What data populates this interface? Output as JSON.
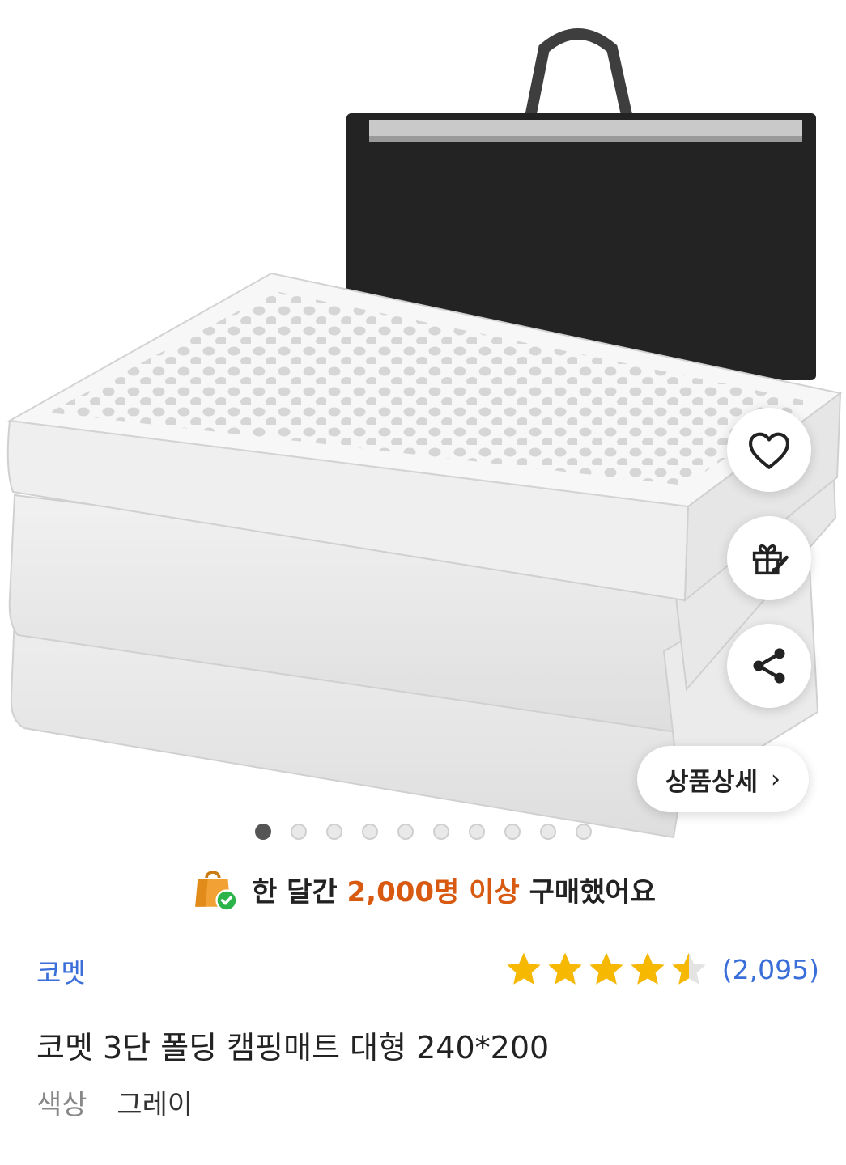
{
  "product": {
    "brand": "코멧",
    "title": "코멧 3단 폴딩 캠핑매트 대형 240*200",
    "rating_stars": 4.5,
    "review_count": "(2,095)",
    "option_label": "색상",
    "option_value": "그레이"
  },
  "gallery": {
    "image_alt": "코멧 3단 폴딩 캠핑매트",
    "total_images": 10,
    "current_index": 1,
    "detail_button_label": "상품상세",
    "detail_button_chevron": "›"
  },
  "actions": {
    "wishlist_icon": "heart-icon",
    "gift_icon": "gift-icon",
    "share_icon": "share-icon"
  },
  "purchase_notice": {
    "prefix": "한 달간 ",
    "highlight": "2,000명 이상",
    "suffix": " 구매했어요"
  },
  "colors": {
    "link_blue": "#3a6ed8",
    "highlight_orange": "#d85a10",
    "star_gold": "#f6b800"
  }
}
